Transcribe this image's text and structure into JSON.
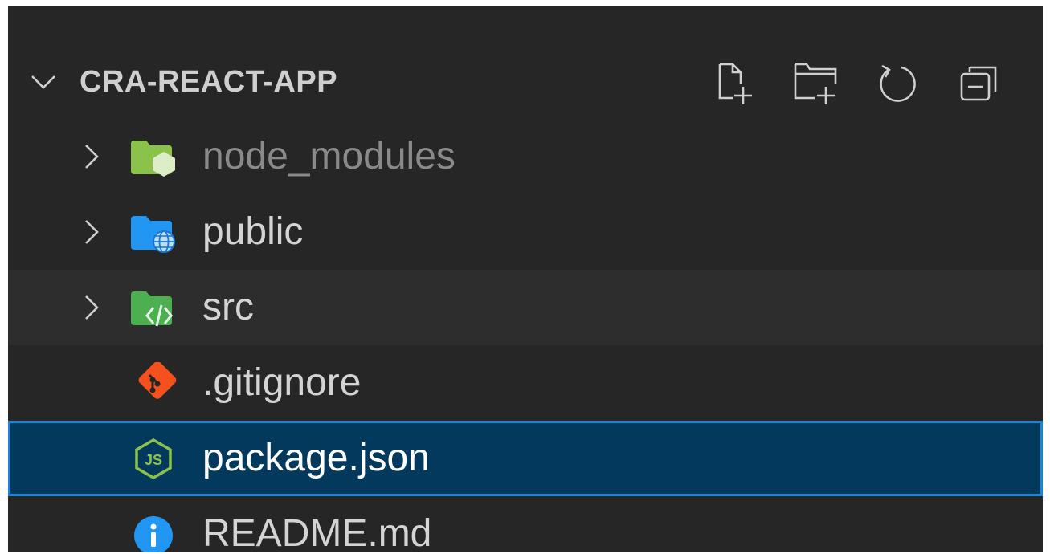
{
  "explorer": {
    "title": "CRA-REACT-APP",
    "actions": [
      {
        "name": "new-file-button",
        "icon": "new-file-icon"
      },
      {
        "name": "new-folder-button",
        "icon": "new-folder-icon"
      },
      {
        "name": "refresh-button",
        "icon": "refresh-icon"
      },
      {
        "name": "collapse-all-button",
        "icon": "collapse-all-icon"
      }
    ],
    "items": [
      {
        "label": "node_modules",
        "type": "folder",
        "icon": "node-modules-folder-icon",
        "state": "dimmed"
      },
      {
        "label": "public",
        "type": "folder",
        "icon": "public-folder-icon"
      },
      {
        "label": "src",
        "type": "folder",
        "icon": "src-folder-icon",
        "state": "hovered"
      },
      {
        "label": ".gitignore",
        "type": "file",
        "icon": "git-icon"
      },
      {
        "label": "package.json",
        "type": "file",
        "icon": "nodejs-icon",
        "state": "selected"
      },
      {
        "label": "README.md",
        "type": "file",
        "icon": "info-icon"
      }
    ]
  },
  "colors": {
    "background": "#262626",
    "selection": "#04395e",
    "selection_border": "#1f83d8",
    "hover": "#2d2d2d"
  }
}
